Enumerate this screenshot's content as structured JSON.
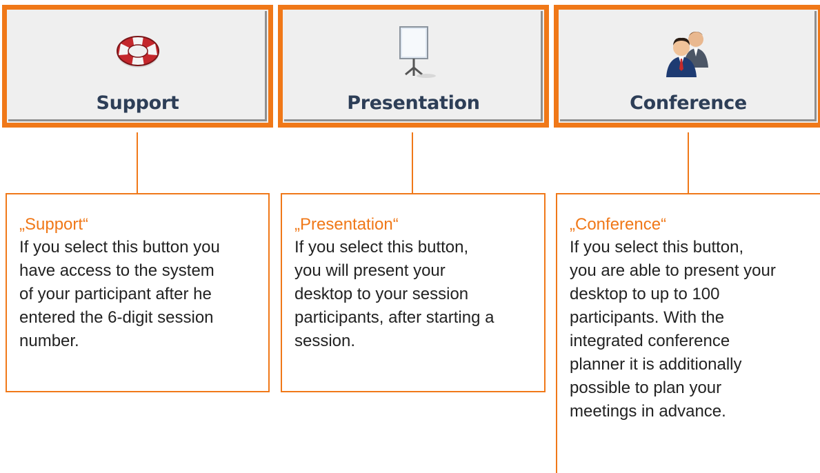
{
  "modes": [
    {
      "label": "Support",
      "icon": "lifebuoy-icon",
      "description_title": "„Support“",
      "description": "If you select this button you\nhave access to the system\nof your participant after he\nentered the 6-digit session\nnumber."
    },
    {
      "label": "Presentation",
      "icon": "projection-screen-icon",
      "description_title": "„Presentation“",
      "description": "If you select this button,\nyou will present your\ndesktop to your session\nparticipants, after starting a\nsession."
    },
    {
      "label": "Conference",
      "icon": "people-icon",
      "description_title": "„Conference“",
      "description": "If you select this button,\nyou are able to present your\ndesktop to up to 100\nparticipants. With the\nintegrated conference\nplanner it is additionally\npossible to plan your\nmeetings in advance."
    }
  ],
  "colors": {
    "accent": "#f07818",
    "button_bg": "#efefef",
    "button_label": "#2d3e57",
    "body_text": "#222222"
  }
}
